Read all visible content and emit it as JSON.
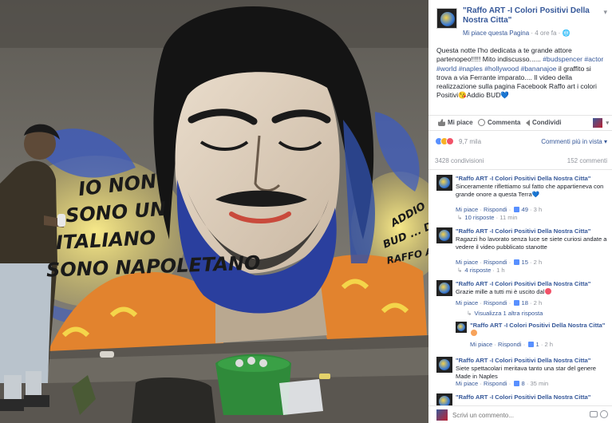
{
  "photo": {
    "mural_text": {
      "line1": "IO NON",
      "line2": "SONO UN",
      "line3": "ITALIANO",
      "line4": "SONO NAPOLETANO",
      "right1": "ADDIO",
      "right2": "BUD ... DA",
      "right3": "RAFFO ART"
    }
  },
  "post": {
    "page_name": "\"Raffo ART -I Colori Positivi Della Nostra Citta\"",
    "like_page": "Mi piace questa Pagina",
    "time": "· 4 ore fa ·",
    "text_intro": "Questa notte l'ho dedicata a te grande attore partenopeo!!!!! Mito indiscusso...... ",
    "tags": "#budspencer #actor #world #naples #hollywood #bananajoe",
    "text_rest": " il graffito si trova a via Ferrante imparato.... Il video della realizzazione sulla pagina Facebook Raffo art i colori Positivi😘Addio BUD💙",
    "actions": {
      "like": "Mi piace",
      "comment": "Commenta",
      "share": "Condividi"
    },
    "reactions_count": "9,7 mila",
    "sort_label": "Commenti più in vista",
    "shares": "3428 condivisioni",
    "comments_count": "152 commenti"
  },
  "comments": [
    {
      "author": "\"Raffo ART -I Colori Positivi Della Nostra Citta\"",
      "text": "Sinceramente riflettiamo sul fatto che appartieneva con grande onore a questa Terra💙",
      "like": "Mi piace",
      "reply": "Rispondi",
      "likes": "49",
      "time": "3 h",
      "replies_link": "10 risposte",
      "replies_time": "11 min"
    },
    {
      "author": "\"Raffo ART -I Colori Positivi Della Nostra Citta\"",
      "text": "Ragazzi ho lavorato senza luce se siete curiosi andate a vedere il video pubblicato stanotte",
      "like": "Mi piace",
      "reply": "Rispondi",
      "likes": "15",
      "time": "2 h",
      "replies_link": "4 risposte",
      "replies_time": "1 h"
    },
    {
      "author": "\"Raffo ART -I Colori Positivi Della Nostra Citta\"",
      "text": "Grazie mille a tutti mi è uscito dal",
      "like": "Mi piace",
      "reply": "Rispondi",
      "likes": "18",
      "time": "2 h",
      "replies_link": "Visualizza 1 altra risposta"
    },
    {
      "author": "\"Raffo ART -I Colori Positivi Della Nostra Citta\"",
      "like": "Mi piace",
      "reply": "Rispondi",
      "likes": "1",
      "time": "2 h"
    },
    {
      "author": "\"Raffo ART -I Colori Positivi Della Nostra Citta\"",
      "text": "Siete spettacolari meritava tanto una star del genere Made in Naples",
      "like": "Mi piace",
      "reply": "Rispondi",
      "likes": "8",
      "time": "35 min"
    },
    {
      "author": "\"Raffo ART -I Colori Positivi Della Nostra Citta\""
    }
  ],
  "comment_box": {
    "placeholder": "Scrivi un commento..."
  },
  "colors": {
    "link": "#365899",
    "meta": "#90949c",
    "text": "#1d2129"
  }
}
